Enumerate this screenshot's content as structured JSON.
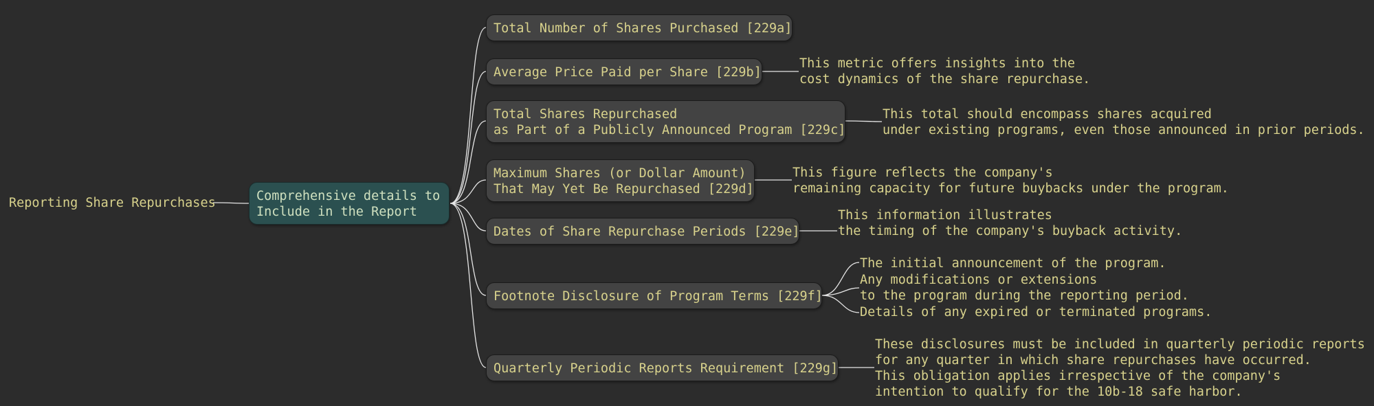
{
  "root": {
    "label": "Reporting Share Repurchases"
  },
  "center": {
    "label": "Comprehensive details to\nInclude in the Report"
  },
  "branches": [
    {
      "label": "Total Number of Shares Purchased [229a]",
      "notes": []
    },
    {
      "label": "Average Price Paid per Share [229b]",
      "notes": [
        "This metric offers insights into the\ncost dynamics of the share repurchase."
      ]
    },
    {
      "label": "Total Shares Repurchased\nas Part of a Publicly Announced Program [229c]",
      "notes": [
        "This total should encompass shares acquired\nunder existing programs, even those announced in prior periods."
      ]
    },
    {
      "label": "Maximum Shares (or Dollar Amount)\nThat May Yet Be Repurchased [229d]",
      "notes": [
        "This figure reflects the company's\nremaining capacity for future buybacks under the program."
      ]
    },
    {
      "label": "Dates of Share Repurchase Periods [229e]",
      "notes": [
        "This information illustrates\nthe timing of the company's buyback activity."
      ]
    },
    {
      "label": "Footnote Disclosure of Program Terms [229f]",
      "notes": [
        "The initial announcement of the program.",
        "Any modifications or extensions\nto the program during the reporting period.",
        "Details of any expired or terminated programs."
      ]
    },
    {
      "label": "Quarterly Periodic Reports Requirement [229g]",
      "notes": [
        "These disclosures must be included in quarterly periodic reports\nfor any quarter in which share repurchases have occurred.\nThis obligation applies irrespective of the company's\nintention to qualify for the 10b-18 safe harbor."
      ]
    }
  ],
  "colors": {
    "background": "#2c2c2c",
    "text": "#d8d28c",
    "node_fill": "#434343",
    "center_fill": "#2b5050",
    "line": "#e0e0e0"
  }
}
